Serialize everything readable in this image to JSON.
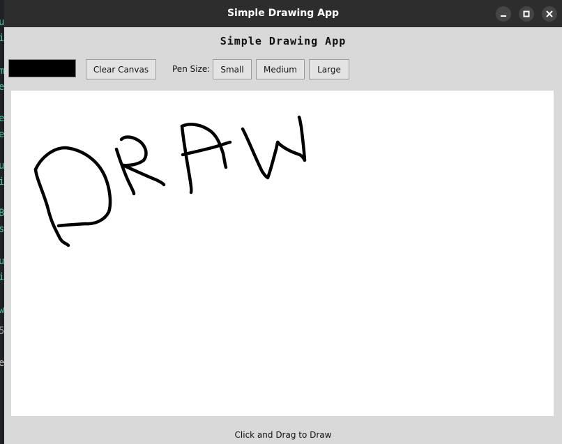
{
  "window": {
    "title": "Simple Drawing App"
  },
  "app": {
    "heading": "Simple Drawing App"
  },
  "toolbar": {
    "color_swatch": "#000000",
    "clear_label": "Clear Canvas",
    "pen_size_label": "Pen Size:",
    "small_label": "Small",
    "medium_label": "Medium",
    "large_label": "Large"
  },
  "canvas": {
    "stroke_color": "#000000"
  },
  "status": {
    "text": "Click and Drag to Draw"
  },
  "colors": {
    "accent_terminal": "#4fc1a8"
  }
}
